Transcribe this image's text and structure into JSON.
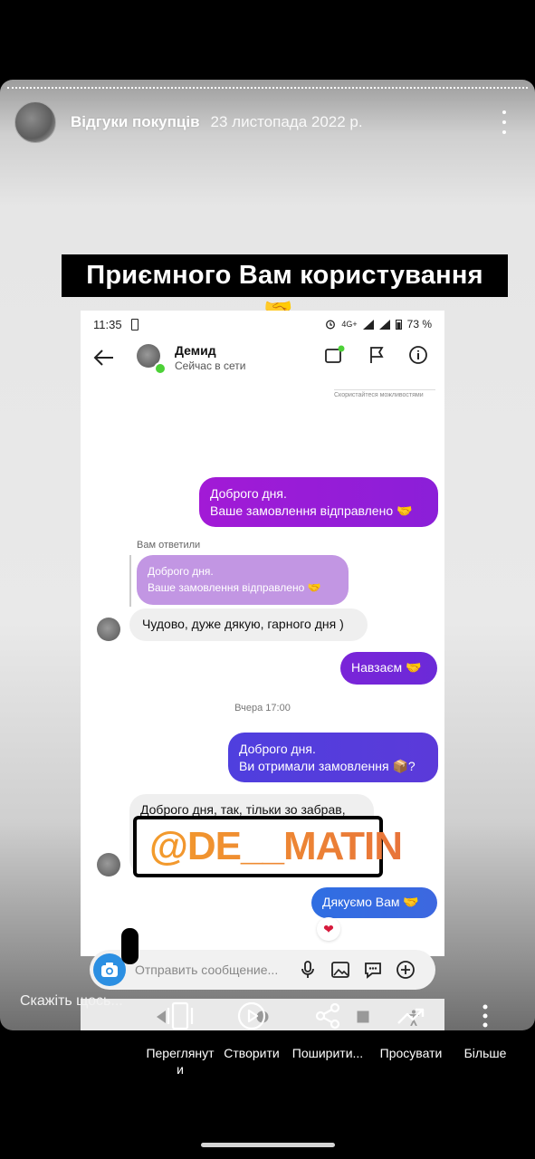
{
  "story": {
    "account_name": "Відгуки покупців",
    "date": "23 листопада 2022 р.",
    "caption": "Приємного Вам користування",
    "caption_emoji": "🤝"
  },
  "screenshot": {
    "status": {
      "time": "11:35",
      "network": "4G+",
      "battery": "73 %"
    },
    "header": {
      "name": "Демид",
      "status": "Сейчас в сети"
    },
    "note": "Скористайтеся можливостями",
    "messages": [
      {
        "from": "me",
        "text_line1": "Доброго дня.",
        "text_line2": "Ваше замовлення відправлено 🤝"
      },
      {
        "from": "me_quote_label",
        "text": "Вам ответили"
      },
      {
        "from": "quote",
        "text_line1": "Доброго дня.",
        "text_line2": "Ваше замовлення відправлено 🤝"
      },
      {
        "from": "them",
        "text": "Чудово, дуже дякую, гарного дня )"
      },
      {
        "from": "me",
        "text": "Навзаєм 🤝"
      },
      {
        "from": "system",
        "text": "Вчера 17:00"
      },
      {
        "from": "me",
        "text_line1": "Доброго дня.",
        "text_line2": "Ви отримали замовлення 📦?"
      },
      {
        "from": "them",
        "text": "Доброго дня, так, тільки зо забрав,"
      },
      {
        "from": "me",
        "text": "Дякуємо Вам 🤝"
      }
    ],
    "sticker": "@DE__MATIN",
    "reaction": "❤",
    "composer_placeholder": "Отправить сообщение..."
  },
  "reply_placeholder": "Скажіть щось...",
  "actions": [
    {
      "label": "Переглянут\nи",
      "icon": "preview-icon"
    },
    {
      "label": "Створити",
      "icon": "create-icon"
    },
    {
      "label": "Поширити...",
      "icon": "share-icon"
    },
    {
      "label": "Просувати",
      "icon": "promote-icon"
    },
    {
      "label": "Більше",
      "icon": "more-icon"
    }
  ],
  "colors": {
    "purple": "#9a1dd7",
    "violet": "#6b2ad8",
    "blue": "#3d68e0",
    "sticker_orange": "#f0892d"
  }
}
